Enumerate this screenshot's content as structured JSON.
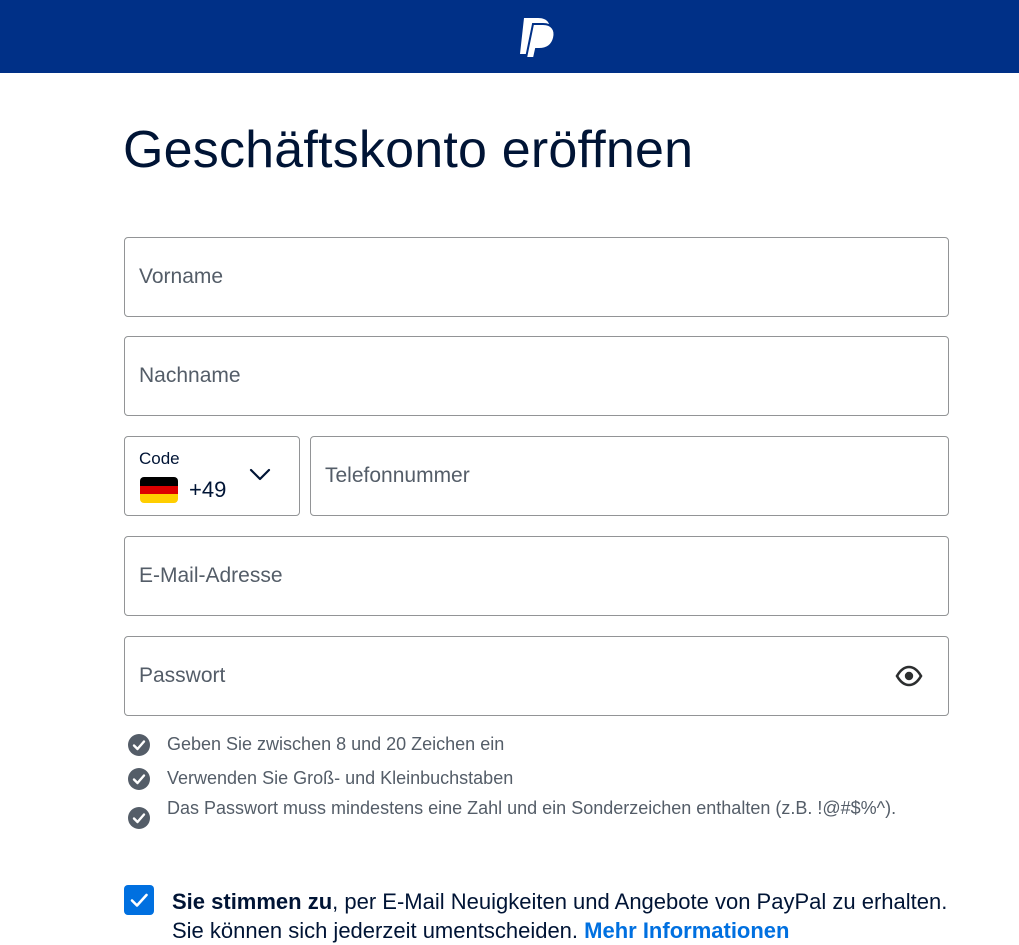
{
  "header": {
    "logo_icon": "paypal-logo-icon",
    "colors": {
      "background": "#003087",
      "logo": "#ffffff"
    }
  },
  "page": {
    "title": "Geschäftskonto eröffnen"
  },
  "form": {
    "first_name": {
      "placeholder": "Vorname",
      "value": ""
    },
    "last_name": {
      "placeholder": "Nachname",
      "value": ""
    },
    "country_code": {
      "label": "Code",
      "value": "+49",
      "flag_icon": "germany-flag-icon",
      "dropdown_icon": "chevron-down-icon"
    },
    "phone": {
      "placeholder": "Telefonnummer",
      "value": ""
    },
    "email": {
      "placeholder": "E-Mail-Adresse",
      "value": ""
    },
    "password": {
      "placeholder": "Passwort",
      "value": "",
      "toggle_icon": "eye-icon"
    },
    "password_requirements": [
      {
        "text": "Geben Sie zwischen 8 und 20 Zeichen ein",
        "met": true,
        "icon": "check-circle-icon"
      },
      {
        "text": "Verwenden Sie Groß- und Kleinbuchstaben",
        "met": true,
        "icon": "check-circle-icon"
      },
      {
        "text": "Das Passwort muss mindestens eine Zahl und ein Sonderzeichen enthalten (z.B. !@#$%^).",
        "met": true,
        "icon": "check-circle-icon"
      }
    ],
    "consent": {
      "checked": true,
      "bold_text": "Sie stimmen zu",
      "text": ", per E-Mail Neuigkeiten und Angebote von PayPal zu erhalten. Sie können sich jederzeit umentscheiden. ",
      "link_text": "Mehr Informationen"
    }
  },
  "colors": {
    "accent": "#0070e0",
    "text": "#001435",
    "muted_text": "#545d68",
    "border": "#929496"
  }
}
